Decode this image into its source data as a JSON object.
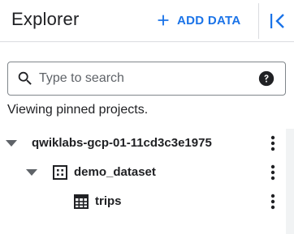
{
  "header": {
    "title": "Explorer",
    "add_data_label": "ADD DATA"
  },
  "search": {
    "placeholder": "Type to search",
    "value": ""
  },
  "pinned_note": "Viewing pinned projects.",
  "tree": {
    "project": {
      "label": "qwiklabs-gcp-01-11cd3c3e1975",
      "expanded": true
    },
    "dataset": {
      "label": "demo_dataset",
      "expanded": true
    },
    "table": {
      "label": "trips"
    }
  },
  "colors": {
    "accent": "#1a73e8",
    "text": "#202124",
    "icon": "#202124",
    "border": "#80868b",
    "divider": "#dadce0"
  },
  "icons": {
    "add": "plus-icon",
    "collapse": "collapse-left-icon",
    "search": "search-icon",
    "help": "help-icon",
    "caret": "caret-down-icon",
    "dataset": "dataset-icon",
    "table": "table-icon",
    "more": "more-vert-icon"
  }
}
